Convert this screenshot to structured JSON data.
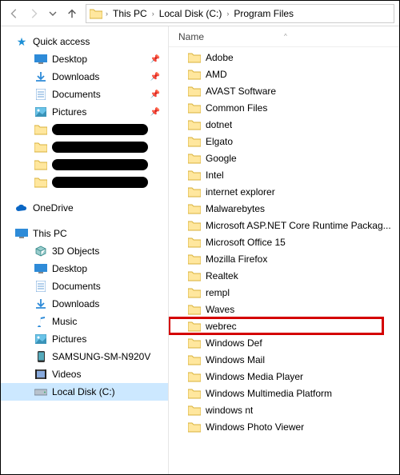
{
  "breadcrumb": {
    "p0": "This PC",
    "p1": "Local Disk (C:)",
    "p2": "Program Files"
  },
  "columns": {
    "name": "Name"
  },
  "nav": {
    "quick_access": "Quick access",
    "desktop": "Desktop",
    "downloads": "Downloads",
    "documents": "Documents",
    "pictures": "Pictures",
    "onedrive": "OneDrive",
    "this_pc": "This PC",
    "objects3d": "3D Objects",
    "desktop2": "Desktop",
    "documents2": "Documents",
    "downloads2": "Downloads",
    "music": "Music",
    "pictures2": "Pictures",
    "samsung": "SAMSUNG-SM-N920V",
    "videos": "Videos",
    "localdisk": "Local Disk (C:)"
  },
  "folders": [
    "Adobe",
    "AMD",
    "AVAST Software",
    "Common Files",
    "dotnet",
    "Elgato",
    "Google",
    "Intel",
    "internet explorer",
    "Malwarebytes",
    "Microsoft ASP.NET Core Runtime Packag...",
    "Microsoft Office 15",
    "Mozilla Firefox",
    "Realtek",
    "rempl",
    "Waves",
    "webrec",
    "Windows Def",
    "Windows Mail",
    "Windows Media Player",
    "Windows Multimedia Platform",
    "windows nt",
    "Windows Photo Viewer"
  ],
  "highlight_folder": "webrec"
}
